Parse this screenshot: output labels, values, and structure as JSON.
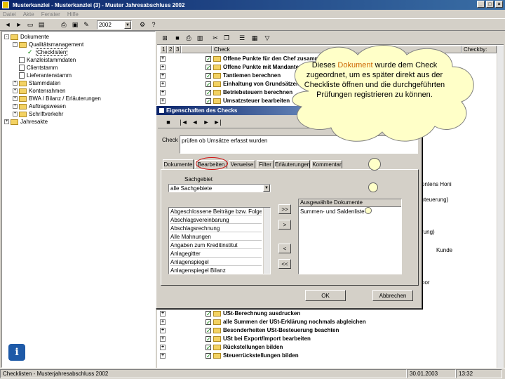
{
  "window": {
    "title": "Musterkanzlei - Musterkanzlei (3) - Muster Jahresabschluss 2002",
    "buttons": [
      "_",
      "□",
      "×"
    ]
  },
  "menu": [
    "Datei",
    "Akte",
    "Fenster",
    "Hilfe"
  ],
  "toolbar": {
    "year": "2002"
  },
  "tree": [
    {
      "label": "Dokumente",
      "level": 0,
      "icon": "folder",
      "pm": "-"
    },
    {
      "label": "Qualitätsmanagement",
      "level": 1,
      "icon": "folder",
      "pm": "-"
    },
    {
      "label": "Checklisten",
      "level": 2,
      "icon": "check",
      "pm": ""
    },
    {
      "label": "Kanzleistammdaten",
      "level": 1,
      "icon": "doc",
      "pm": ""
    },
    {
      "label": "Clientstamm",
      "level": 1,
      "icon": "doc",
      "pm": ""
    },
    {
      "label": "Lieferantenstamm",
      "level": 1,
      "icon": "doc",
      "pm": ""
    },
    {
      "label": "Stammdaten",
      "level": 1,
      "icon": "folder",
      "pm": "+"
    },
    {
      "label": "Kontenrahmen",
      "level": 1,
      "icon": "folder",
      "pm": "+"
    },
    {
      "label": "BWA / Bilanz / Erläuterungen",
      "level": 1,
      "icon": "folder",
      "pm": "+"
    },
    {
      "label": "Auftragswesen",
      "level": 1,
      "icon": "folder",
      "pm": "+"
    },
    {
      "label": "Schriftverkehr",
      "level": 1,
      "icon": "folder",
      "pm": "+"
    },
    {
      "label": "Jahresakte",
      "level": 0,
      "icon": "folder",
      "pm": "+"
    }
  ],
  "list_header": {
    "cols": [
      "1",
      "2",
      "3"
    ],
    "check": "Check",
    "checkby": "Checkby:"
  },
  "list_rows": [
    "Offene Punkte für den Chef zusammenstellen",
    "Offene Punkte mit Mandanten klären",
    "Tantiemen berechnen",
    "Einhaltung von Grundsätzen prüfen",
    "Betriebsteuern berechnen",
    "Umsatzsteuer bearbeiten"
  ],
  "list_rows_bottom": [
    "USt-Berechnung ausdrucken",
    "alle Summen der USt-Erklärung nochmals abgleichen",
    "Besonderheiten USt-Besteuerung beachten",
    "USt bei Export/Import bearbeiten",
    "Rückstellungen bilden",
    "Steuerrückstellungen bilden"
  ],
  "right_fragments": [
    "ontens Honi",
    "steuerung)",
    "rung)",
    "Kunde",
    "bor"
  ],
  "dialog": {
    "title": "Eigenschaften des Checks",
    "check_label": "Check",
    "check_value": "prüfen ob Umsätze erfasst wurden",
    "tabs": [
      "Dokumente",
      "Bearbeiten",
      "Verweise",
      "Filter",
      "Erläuterungen",
      "Kommentar"
    ],
    "sachgebiet_label": "Sachgebiet",
    "sachgebiet_value": "alle Sachgebiete",
    "available": [
      "Abgeschlossene Beiträge bzw. Folgeprüfungen",
      "Abschlagsvereinbarung",
      "Abschlagsrechnung",
      "Alle Mahnungen",
      "Angaben zum Kreditinstitut",
      "Anlagegitter",
      "Anlagenspiegel",
      "Anlagenspiegel Bilanz"
    ],
    "selected_header": "Ausgewählte Dokumente",
    "selected": [
      "Summen- und Saldenliste"
    ],
    "move_buttons": [
      ">>",
      ">",
      "<",
      "<<"
    ],
    "ok": "OK",
    "cancel": "Abbrechen"
  },
  "callout": {
    "before": "Dieses ",
    "highlight": "Dokument",
    "after": " wurde dem Check zugeordnet, um es später direkt aus der Checkliste öffnen und die durchgeführten Prüfungen registrieren zu können."
  },
  "status": {
    "left": "Checklisten - Musterjahresabschluss 2002",
    "date": "30.01.2003",
    "time": "13:32"
  },
  "colors": {
    "title_blue": "#0a246a",
    "highlight_orange": "#cc6600",
    "callout_fill": "#ffffc8"
  }
}
